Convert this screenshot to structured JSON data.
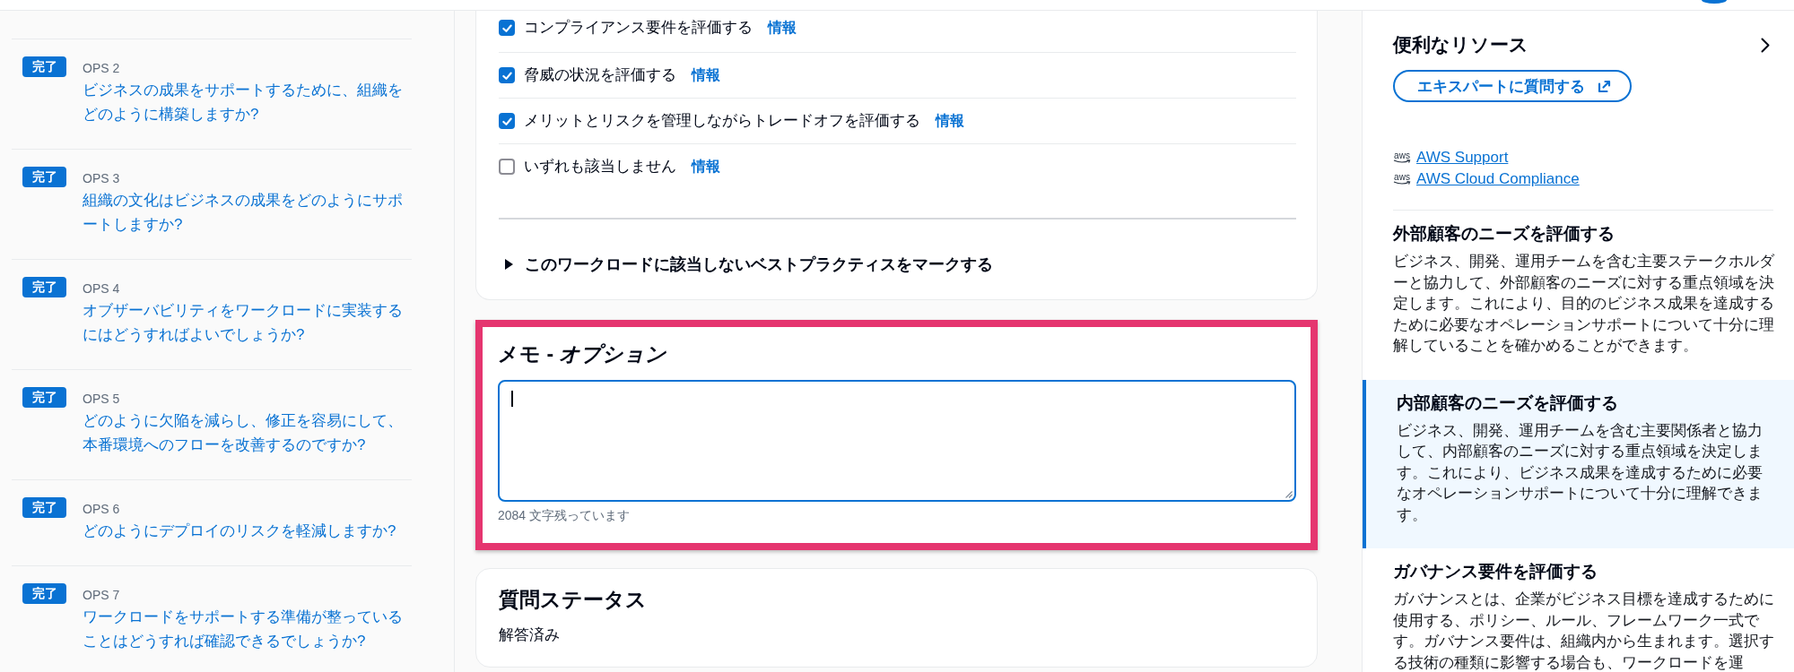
{
  "sidebar": {
    "items": [
      {
        "badge": "完了",
        "label": "OPS 2",
        "question": "ビジネスの成果をサポートするために、組織をどのように構築しますか?"
      },
      {
        "badge": "完了",
        "label": "OPS 3",
        "question": "組織の文化はビジネスの成果をどのようにサポートしますか?"
      },
      {
        "badge": "完了",
        "label": "OPS 4",
        "question": "オブザーバビリティをワークロードに実装するにはどうすればよいでしょうか?"
      },
      {
        "badge": "完了",
        "label": "OPS 5",
        "question": "どのように欠陥を減らし、修正を容易にして、本番環境へのフローを改善するのですか?"
      },
      {
        "badge": "完了",
        "label": "OPS 6",
        "question": "どのようにデプロイのリスクを軽減しますか?"
      },
      {
        "badge": "完了",
        "label": "OPS 7",
        "question": "ワークロードをサポートする準備が整っていることはどうすれば確認できるでしょうか?"
      }
    ]
  },
  "best_practices": {
    "choices": [
      {
        "label": "コンプライアンス要件を評価する",
        "checked": true,
        "info": "情報"
      },
      {
        "label": "脅威の状況を評価する",
        "checked": true,
        "info": "情報"
      },
      {
        "label": "メリットとリスクを管理しながらトレードオフを評価する",
        "checked": true,
        "info": "情報"
      },
      {
        "label": "いずれも該当しません",
        "checked": false,
        "info": "情報"
      }
    ],
    "expander": {
      "label": "このワークロードに該当しないベストプラクティスをマークする",
      "expanded": false
    }
  },
  "notes": {
    "title": "メモ - *オプション*",
    "highlighted": true,
    "focused": true,
    "helper": "2084 文字残っています"
  },
  "question_status": {
    "title": "質問ステータス",
    "value": "解答済み"
  },
  "resources": {
    "title": "便利なリソース",
    "button": "エキスパートに質問する",
    "links": [
      {
        "logo": "aws",
        "label": "AWS Support"
      },
      {
        "logo": "aws",
        "label": "AWS Cloud Compliance"
      }
    ],
    "topics": [
      {
        "title": "外部顧客のニーズを評価する",
        "body": "ビジネス、開発、運用チームを含む主要ステークホルダーと協力して、外部顧客のニーズに対する重点領域を決定します。これにより、目的のビジネス成果を達成するために必要なオペレーションサポートについて十分に理解していることを確かめることができます。",
        "selected": false
      },
      {
        "title": "内部顧客のニーズを評価する",
        "body": "ビジネス、開発、運用チームを含む主要関係者と協力して、内部顧客のニーズに対する重点領域を決定します。これにより、ビジネス成果を達成するために必要なオペレーションサポートについて十分に理解できます。",
        "selected": true
      },
      {
        "title": "ガバナンス要件を評価する",
        "body": "ガバナンスとは、企業がビジネス目標を達成するために使用する、ポリシー、ルール、フレームワーク一式です。ガバナンス要件は、組織内から生まれます。選択する技術の種類に影響する場合も、ワークロードを運",
        "selected": false
      }
    ]
  }
}
